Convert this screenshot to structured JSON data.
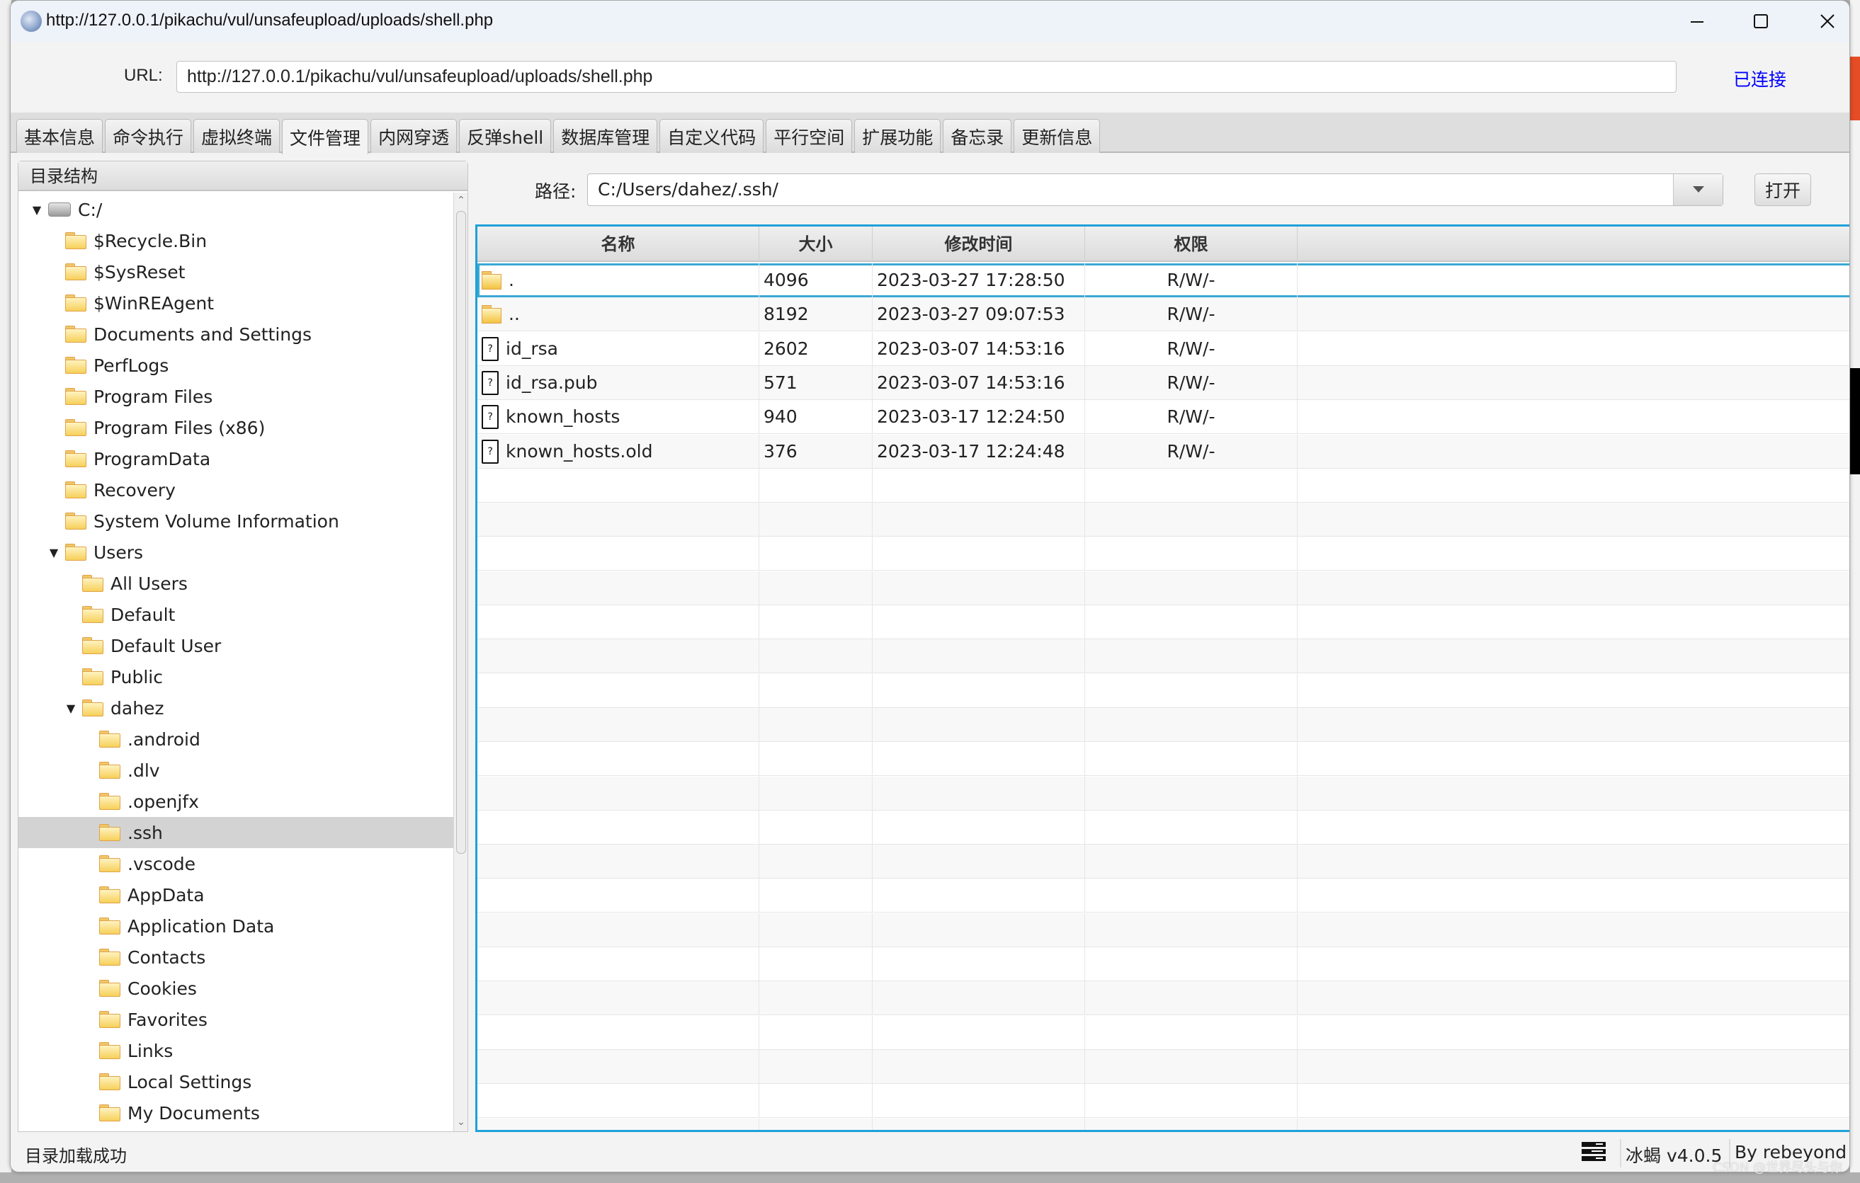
{
  "window": {
    "title": "http://127.0.0.1/pikachu/vul/unsafeupload/uploads/shell.php",
    "controls": {
      "minimize": "minimize",
      "maximize": "maximize",
      "close": "close"
    }
  },
  "url_bar": {
    "label": "URL:",
    "value": "http://127.0.0.1/pikachu/vul/unsafeupload/uploads/shell.php",
    "status": "已连接",
    "status_color": "#0000ff"
  },
  "tabs": [
    {
      "label": "基本信息",
      "active": false
    },
    {
      "label": "命令执行",
      "active": false
    },
    {
      "label": "虚拟终端",
      "active": false
    },
    {
      "label": "文件管理",
      "active": true
    },
    {
      "label": "内网穿透",
      "active": false
    },
    {
      "label": "反弹shell",
      "active": false
    },
    {
      "label": "数据库管理",
      "active": false
    },
    {
      "label": "自定义代码",
      "active": false
    },
    {
      "label": "平行空间",
      "active": false
    },
    {
      "label": "扩展功能",
      "active": false
    },
    {
      "label": "备忘录",
      "active": false
    },
    {
      "label": "更新信息",
      "active": false
    }
  ],
  "tree": {
    "header": "目录结构",
    "nodes": [
      {
        "label": "C:/",
        "level": 0,
        "expanded": true,
        "icon": "drive"
      },
      {
        "label": "$Recycle.Bin",
        "level": 1,
        "icon": "folder"
      },
      {
        "label": "$SysReset",
        "level": 1,
        "icon": "folder"
      },
      {
        "label": "$WinREAgent",
        "level": 1,
        "icon": "folder"
      },
      {
        "label": "Documents and Settings",
        "level": 1,
        "icon": "folder"
      },
      {
        "label": "PerfLogs",
        "level": 1,
        "icon": "folder"
      },
      {
        "label": "Program Files",
        "level": 1,
        "icon": "folder"
      },
      {
        "label": "Program Files (x86)",
        "level": 1,
        "icon": "folder"
      },
      {
        "label": "ProgramData",
        "level": 1,
        "icon": "folder"
      },
      {
        "label": "Recovery",
        "level": 1,
        "icon": "folder"
      },
      {
        "label": "System Volume Information",
        "level": 1,
        "icon": "folder"
      },
      {
        "label": "Users",
        "level": 1,
        "expanded": true,
        "icon": "folder"
      },
      {
        "label": "All Users",
        "level": 2,
        "icon": "folder"
      },
      {
        "label": "Default",
        "level": 2,
        "icon": "folder"
      },
      {
        "label": "Default User",
        "level": 2,
        "icon": "folder"
      },
      {
        "label": "Public",
        "level": 2,
        "icon": "folder"
      },
      {
        "label": "dahez",
        "level": 2,
        "expanded": true,
        "icon": "folder"
      },
      {
        "label": ".android",
        "level": 3,
        "icon": "folder"
      },
      {
        "label": ".dlv",
        "level": 3,
        "icon": "folder"
      },
      {
        "label": ".openjfx",
        "level": 3,
        "icon": "folder"
      },
      {
        "label": ".ssh",
        "level": 3,
        "icon": "folder",
        "selected": true
      },
      {
        "label": ".vscode",
        "level": 3,
        "icon": "folder"
      },
      {
        "label": "AppData",
        "level": 3,
        "icon": "folder"
      },
      {
        "label": "Application Data",
        "level": 3,
        "icon": "folder"
      },
      {
        "label": "Contacts",
        "level": 3,
        "icon": "folder"
      },
      {
        "label": "Cookies",
        "level": 3,
        "icon": "folder"
      },
      {
        "label": "Favorites",
        "level": 3,
        "icon": "folder"
      },
      {
        "label": "Links",
        "level": 3,
        "icon": "folder"
      },
      {
        "label": "Local Settings",
        "level": 3,
        "icon": "folder"
      },
      {
        "label": "My Documents",
        "level": 3,
        "icon": "folder"
      }
    ]
  },
  "path_bar": {
    "label": "路径:",
    "value": "C:/Users/dahez/.ssh/",
    "open_button": "打开"
  },
  "file_table": {
    "columns": [
      "名称",
      "大小",
      "修改时间",
      "权限",
      ""
    ],
    "rows": [
      {
        "name": ".",
        "type": "folder",
        "size": "4096",
        "modified": "2023-03-27 17:28:50",
        "perm": "R/W/-",
        "selected": true
      },
      {
        "name": "..",
        "type": "folder",
        "size": "8192",
        "modified": "2023-03-27 09:07:53",
        "perm": "R/W/-"
      },
      {
        "name": "id_rsa",
        "type": "file",
        "size": "2602",
        "modified": "2023-03-07 14:53:16",
        "perm": "R/W/-"
      },
      {
        "name": "id_rsa.pub",
        "type": "file",
        "size": "571",
        "modified": "2023-03-07 14:53:16",
        "perm": "R/W/-"
      },
      {
        "name": "known_hosts",
        "type": "file",
        "size": "940",
        "modified": "2023-03-17 12:24:50",
        "perm": "R/W/-"
      },
      {
        "name": "known_hosts.old",
        "type": "file",
        "size": "376",
        "modified": "2023-03-17 12:24:48",
        "perm": "R/W/-"
      }
    ],
    "empty_rows": 20
  },
  "status_bar": {
    "message": "目录加载成功",
    "version": "冰蝎 v4.0.5",
    "author": "By rebeyond"
  },
  "watermark": "CSDN @世界尽头与你",
  "colors": {
    "accent": "#1da1d8",
    "selected_tree_row": "#d3d3d3",
    "titlebar": "#eef2f9"
  }
}
